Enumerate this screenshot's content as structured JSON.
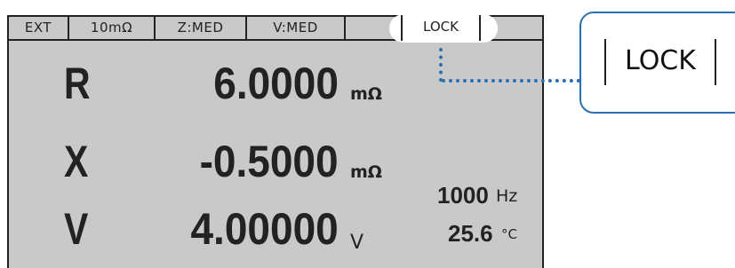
{
  "status_bar": {
    "trigger": "EXT",
    "range": "10mΩ",
    "z_speed": "Z:MED",
    "v_speed": "V:MED",
    "lock": "LOCK"
  },
  "readings": {
    "r": {
      "param": "R",
      "value": "6.0000",
      "unit": "mΩ"
    },
    "x": {
      "param": "X",
      "value": "-0.5000",
      "unit": "mΩ"
    },
    "v": {
      "param": "V",
      "value": "4.00000",
      "unit": "V"
    }
  },
  "frequency": {
    "value": "1000",
    "unit": "Hz"
  },
  "temperature": {
    "value": "25.6",
    "unit": "°C"
  },
  "callout": {
    "lock": "LOCK"
  },
  "colors": {
    "lcd_background": "#c9c9c9",
    "callout_border": "#2b6fb3",
    "text": "#222222"
  }
}
